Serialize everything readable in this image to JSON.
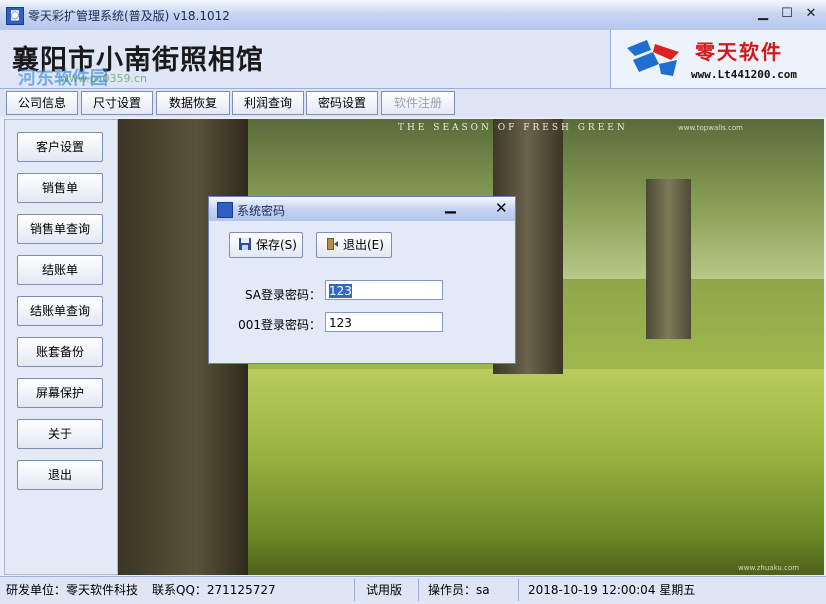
{
  "window": {
    "icon": "app-icon",
    "title": "零天彩扩管理系统(普及版)  v18.1012",
    "minimize": "▁",
    "maximize": "☐",
    "close": "✕"
  },
  "header": {
    "studio_name": "襄阳市小南街照相馆",
    "watermark": "河东软件园",
    "watermark_url": "www.pc0359.cn",
    "logo": {
      "brand": "零天软件",
      "site": "www.Lt441200.com",
      "mark_colors": [
        "#1e6fd1",
        "#e02020"
      ]
    }
  },
  "tabs": [
    {
      "label": "公司信息",
      "enabled": true
    },
    {
      "label": "尺寸设置",
      "enabled": true
    },
    {
      "label": "数据恢复",
      "enabled": true
    },
    {
      "label": "利润查询",
      "enabled": true
    },
    {
      "label": "密码设置",
      "enabled": true
    },
    {
      "label": "软件注册",
      "enabled": false
    }
  ],
  "sidebar": {
    "items": [
      {
        "label": "客户设置"
      },
      {
        "label": "销售单"
      },
      {
        "label": "销售单查询"
      },
      {
        "label": "结账单"
      },
      {
        "label": "结账单查询"
      },
      {
        "label": "账套备份"
      },
      {
        "label": "屏幕保护"
      },
      {
        "label": "关于"
      },
      {
        "label": "退出"
      }
    ]
  },
  "background_photo": {
    "caption": "THE SEASON OF FRESH GREEN",
    "source": "www.topwalls.com",
    "credit": "www.zhuaku.com"
  },
  "dialog": {
    "title": "系统密码",
    "minimize": "▁",
    "close": "✕",
    "save_label": "保存(S)",
    "exit_label": "退出(E)",
    "fields": {
      "sa_label": "SA登录密码：",
      "sa_value": "123",
      "p001_label": "001登录密码：",
      "p001_value": "123"
    }
  },
  "status": {
    "developer": "研发单位：零天软件科技",
    "qq": "联系QQ：271125727",
    "edition": "试用版",
    "operator": "操作员：sa",
    "datetime": "2018-10-19 12:00:04 星期五"
  }
}
